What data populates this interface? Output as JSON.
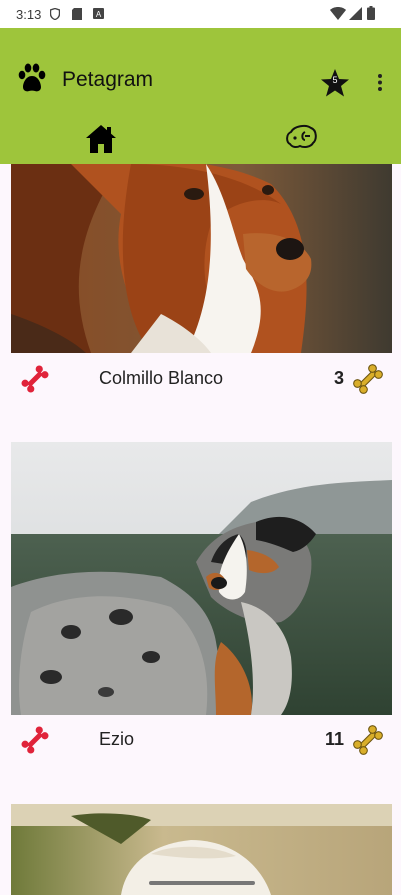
{
  "status_bar": {
    "time": "3:13",
    "icons_left": [
      "shield-icon",
      "sd-card-icon",
      "font-a-icon"
    ],
    "icons_right": [
      "wifi-icon",
      "signal-icon",
      "battery-icon"
    ]
  },
  "appbar": {
    "title": "Petagram",
    "favorites_badge": "5",
    "color": "#9ec53b",
    "tabs": [
      {
        "name": "home-tab",
        "icon": "home-icon"
      },
      {
        "name": "dog-profile-tab",
        "icon": "dog-face-icon"
      }
    ]
  },
  "pets": [
    {
      "name": "Colmillo Blanco",
      "likes": "3"
    },
    {
      "name": "Ezio",
      "likes": "11"
    }
  ],
  "colors": {
    "like_bone": "#e0233a",
    "rating_bone": "#c9a01f"
  }
}
